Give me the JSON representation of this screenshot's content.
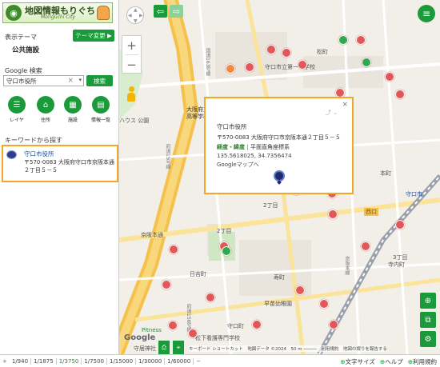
{
  "logo": {
    "title": "地図情報もりぐち",
    "subtitle": "Moriguchi City"
  },
  "sidebar": {
    "theme_label": "表示テーマ",
    "theme_button": "テーマ変更 ▶",
    "theme_value": "公共施設",
    "google_label": "Google 検索",
    "search_value": "守口市役所",
    "search_button": "検索",
    "tools": [
      {
        "label": "レイヤ",
        "icon": "layers-icon"
      },
      {
        "label": "住所",
        "icon": "house-icon"
      },
      {
        "label": "施設",
        "icon": "building-icon"
      },
      {
        "label": "情報一覧",
        "icon": "list-icon"
      }
    ],
    "keyword_label": "キーワードから探す",
    "result": {
      "name": "守口市役所",
      "address": "〒570-0083 大阪府守口市京阪本通２丁目５－５"
    },
    "collapse": "«"
  },
  "map": {
    "labels": {
      "school1": "守口市立第一中学校",
      "matsumachi": "松町",
      "osaka_inst": "大阪府立大阪工科高等学校",
      "ryokuchi": "ハウス 公園",
      "honmachi": "本町",
      "moriguchi_st": "守口市",
      "nishiguchi": "西口",
      "keihan_dori": "京阪本通",
      "chome2a": "2丁目",
      "chome2b": "2丁目",
      "chome3": "3丁目",
      "hiyoshi": "日吉町",
      "kotobuki": "寿町",
      "teraguchi": "寺内町",
      "higashi": "東郷通",
      "waseda": "早苗幼稚園",
      "fitness": "Pitness",
      "moriguchi_jinja": "守居神社",
      "matsushita": "松下看護専門学校",
      "moriguchi_town": "守口町",
      "route1": "国道163号線",
      "route2": "府道15号線",
      "route3": "府道156号線",
      "keihan": "京阪本線"
    },
    "info": {
      "title": "守口市役所",
      "address": "〒570-0083 大阪府守口市京阪本通２丁目５－５",
      "latlng_label": "経度・緯度",
      "plane_label": "平面直角座標系",
      "coords": "135.5618025, 34.7356474",
      "gmaps": "Googleマップへ"
    },
    "attribution": "キーボード ショートカット　地図データ ©2024　50 m ─────　利用規約　地図の誤りを報告する",
    "google": "Google"
  },
  "bottom": {
    "scales": [
      "1/940",
      "1/1875",
      "1/3750",
      "1/7500",
      "1/15000",
      "1/30000",
      "1/60000"
    ],
    "active_scale": "1/3750",
    "links": [
      "文字サイズ",
      "ヘルプ",
      "利用規約"
    ]
  },
  "colors": {
    "accent": "#1a9a3a",
    "highlight": "#f5a623",
    "poi": "#e25757"
  }
}
